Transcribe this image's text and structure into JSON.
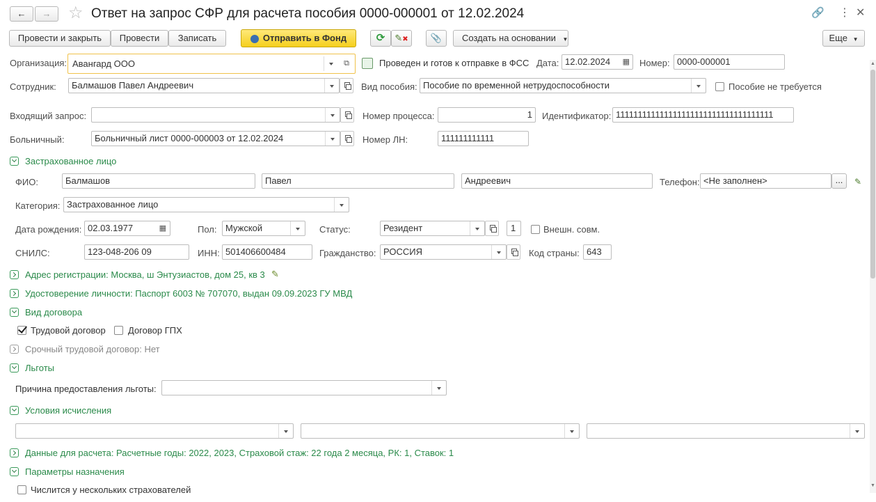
{
  "window": {
    "title": "Ответ на запрос СФР для расчета пособия 0000-000001 от 12.02.2024"
  },
  "toolbar": {
    "post_close": "Провести и закрыть",
    "post": "Провести",
    "save": "Записать",
    "send_fund": "Отправить в Фонд",
    "create_based": "Создать на основании",
    "more": "Еще"
  },
  "header": {
    "org_label": "Организация:",
    "org_value": "Авангард ООО",
    "status_text": "Проведен и готов к отправке в ФСС",
    "date_label": "Дата:",
    "date_value": "12.02.2024",
    "number_label": "Номер:",
    "number_value": "0000-000001",
    "employee_label": "Сотрудник:",
    "employee_value": "Балмашов Павел Андреевич",
    "benefit_type_label": "Вид пособия:",
    "benefit_type_value": "Пособие по временной нетрудоспособности",
    "benefit_not_required": "Пособие не требуется",
    "incoming_label": "Входящий запрос:",
    "incoming_value": "",
    "process_num_label": "Номер процесса:",
    "process_num_value": "1",
    "identifier_label": "Идентификатор:",
    "identifier_value": "111111111111111111111111111111111111",
    "sick_label": "Больничный:",
    "sick_value": "Больничный лист 0000-000003 от 12.02.2024",
    "ln_label": "Номер ЛН:",
    "ln_value": "111111111111"
  },
  "insured": {
    "section_title": "Застрахованное лицо",
    "fio_label": "ФИО:",
    "last_name": "Балмашов",
    "first_name": "Павел",
    "middle_name": "Андреевич",
    "phone_label": "Телефон:",
    "phone_value": "<Не заполнен>",
    "phone_btn": "...",
    "category_label": "Категория:",
    "category_value": "Застрахованное лицо",
    "birth_label": "Дата рождения:",
    "birth_value": "02.03.1977",
    "sex_label": "Пол:",
    "sex_value": "Мужской",
    "status_label": "Статус:",
    "status_value": "Резидент",
    "status_num": "1",
    "ext_combo": "Внешн. совм.",
    "snils_label": "СНИЛС:",
    "snils_value": "123-048-206 09",
    "inn_label": "ИНН:",
    "inn_value": "501406600484",
    "citizenship_label": "Гражданство:",
    "citizenship_value": "РОССИЯ",
    "country_code_label": "Код страны:",
    "country_code_value": "643"
  },
  "sections": {
    "address": "Адрес регистрации: Москва, ш Энтузиастов, дом 25, кв 3",
    "identity": "Удостоверение личности: Паспорт 6003 № 707070, выдан 09.09.2023 ГУ МВД",
    "contract_type": "Вид договора",
    "labor_contract": "Трудовой договор",
    "gph_contract": "Договор ГПХ",
    "fixed_term": "Срочный трудовой договор: Нет",
    "benefits": "Льготы",
    "benefit_reason_label": "Причина предоставления льготы:",
    "calc_conditions": "Условия исчисления",
    "calc_data": "Данные для расчета: Расчетные годы: 2022, 2023, Страховой стаж: 22 года 2 месяца, РК: 1, Ставок: 1",
    "assignment_params": "Параметры назначения",
    "multiple_insurers": "Числится у нескольких страхователей"
  }
}
